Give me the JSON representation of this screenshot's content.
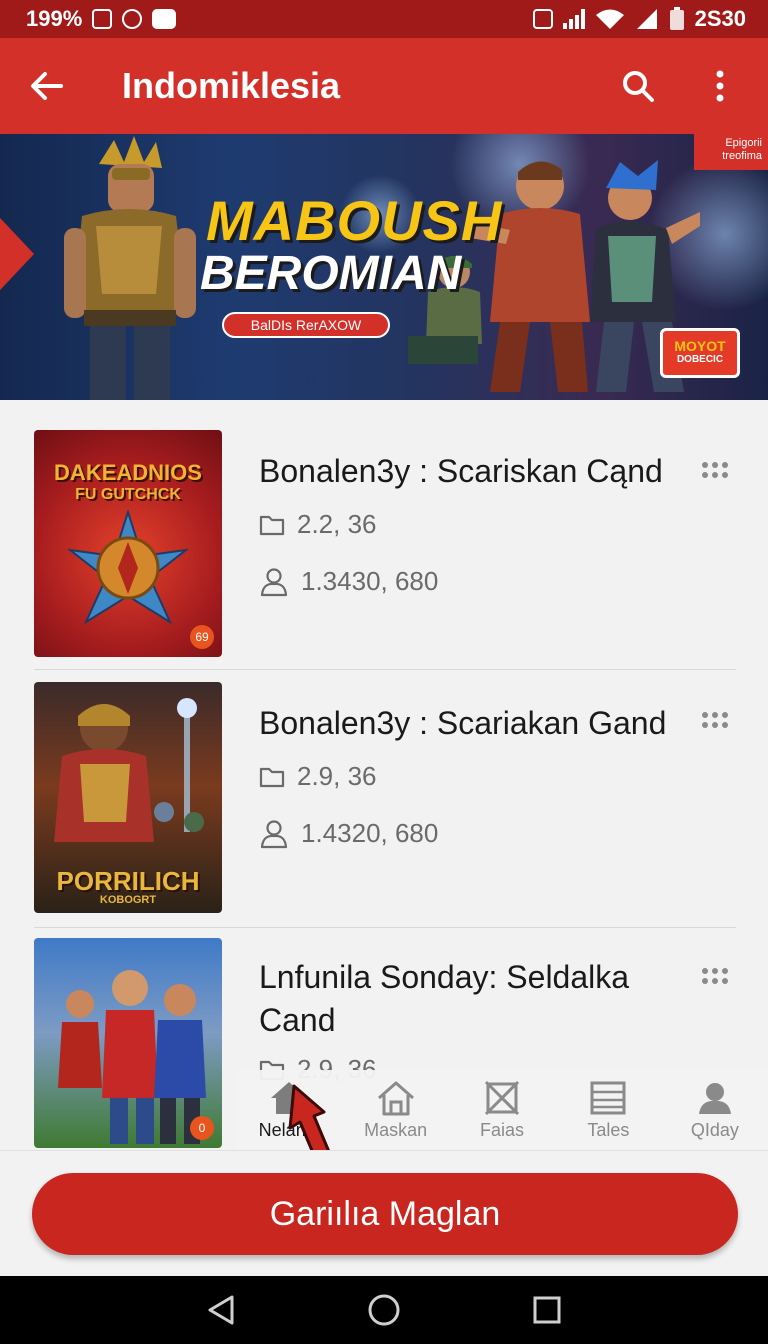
{
  "status_bar": {
    "battery_pct": "199%",
    "time": "2S30"
  },
  "app_bar": {
    "title": "Indomiklesia"
  },
  "banner": {
    "title_line1": "MABOUSH",
    "title_line2": "BEROMIAN",
    "pill": "BalDIs RerAXOW",
    "corner_line1": "Epigorii",
    "corner_line2": "treofima",
    "badge_line1": "MOYOT",
    "badge_line2": "DOBECIC"
  },
  "items": [
    {
      "title": "Bonalen3y : Scariskan Cąnd",
      "version": "2.2, 36",
      "downloads": "1.3430, 680",
      "thumb_title": "DAKEADNIOS",
      "thumb_sub": "FU GUTCHCK",
      "thumb_tag": "69"
    },
    {
      "title": "Bonalen3y : Scariakan Gand",
      "version": "2.9, 36",
      "downloads": "1.4320, 680",
      "thumb_title": "PORRILICH",
      "thumb_sub": "KOBOGRT"
    },
    {
      "title": "Lnfunila Sonday: Seldalka Cand",
      "version": "2.9, 36",
      "thumb_tag": "0"
    }
  ],
  "tabs": [
    {
      "label": "Nelanin",
      "icon": "home-icon"
    },
    {
      "label": "Maskan",
      "icon": "house-outline-icon"
    },
    {
      "label": "Faias",
      "icon": "crossed-box-icon"
    },
    {
      "label": "Tales",
      "icon": "table-icon"
    },
    {
      "label": "QIday",
      "icon": "profile-icon"
    }
  ],
  "cta": {
    "label": "Gariılıa Maglan"
  },
  "colors": {
    "primary": "#d3302a",
    "primary_dark": "#a11a1a",
    "accent_yellow": "#f7c515",
    "background": "#f2f2f2"
  }
}
